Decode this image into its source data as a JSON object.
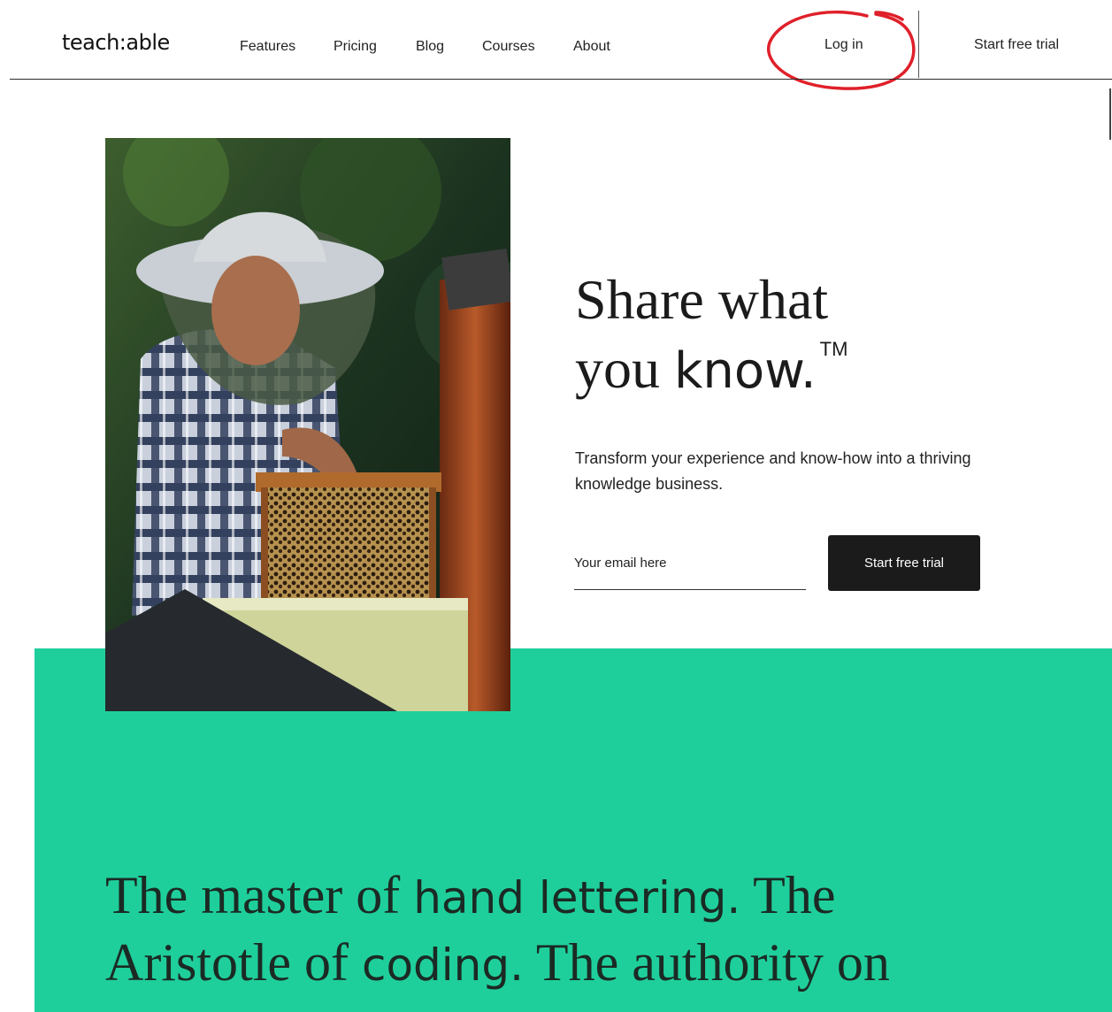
{
  "header": {
    "logo": "teach:able",
    "nav": [
      "Features",
      "Pricing",
      "Blog",
      "Courses",
      "About"
    ],
    "login_label": "Log in",
    "cta_label": "Start free trial"
  },
  "hero": {
    "title_part1": "Share what",
    "title_part2": "you ",
    "title_strong": "know.",
    "trademark": "TM",
    "subcopy": "Transform your experience and know-how into a thriving knowledge business.",
    "email_placeholder": "Your email here",
    "cta_label": "Start free trial"
  },
  "bottom": {
    "t1": "The master of ",
    "s1": "hand lettering.",
    "t2": " The",
    "t3": "Aristotle of ",
    "s2": "coding.",
    "t4": " The authority on"
  },
  "colors": {
    "accent_green": "#1fcf9b",
    "button_dark": "#1b1b1b",
    "annotation_red": "#e0202a"
  }
}
